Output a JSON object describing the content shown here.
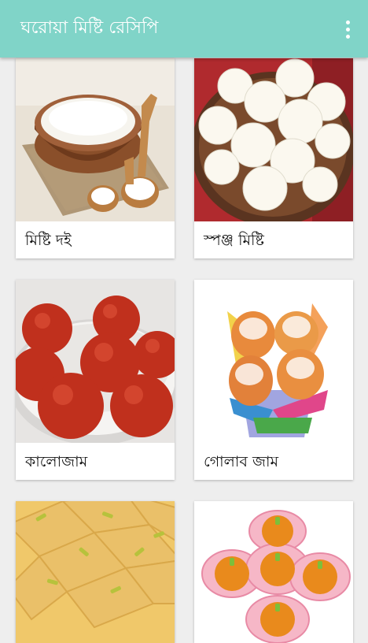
{
  "app": {
    "title": "ঘরোয়া মিষ্টি রেসিপি",
    "menu_icon": "more-vert-icon",
    "bar_color": "#80d4c8"
  },
  "recipes": [
    {
      "label": "মিষ্টি দই",
      "image": "curd-bowl"
    },
    {
      "label": "স্পঞ্জ মিষ্টি",
      "image": "rasgulla-bowl"
    },
    {
      "label": "কালোজাম",
      "image": "gulab-jamun-bowl"
    },
    {
      "label": "গোলাব জাম",
      "image": "sugar-coated-jamun-cups"
    },
    {
      "label": "",
      "image": "barfi-squares"
    },
    {
      "label": "",
      "image": "orange-sweets-paper-cups"
    }
  ]
}
